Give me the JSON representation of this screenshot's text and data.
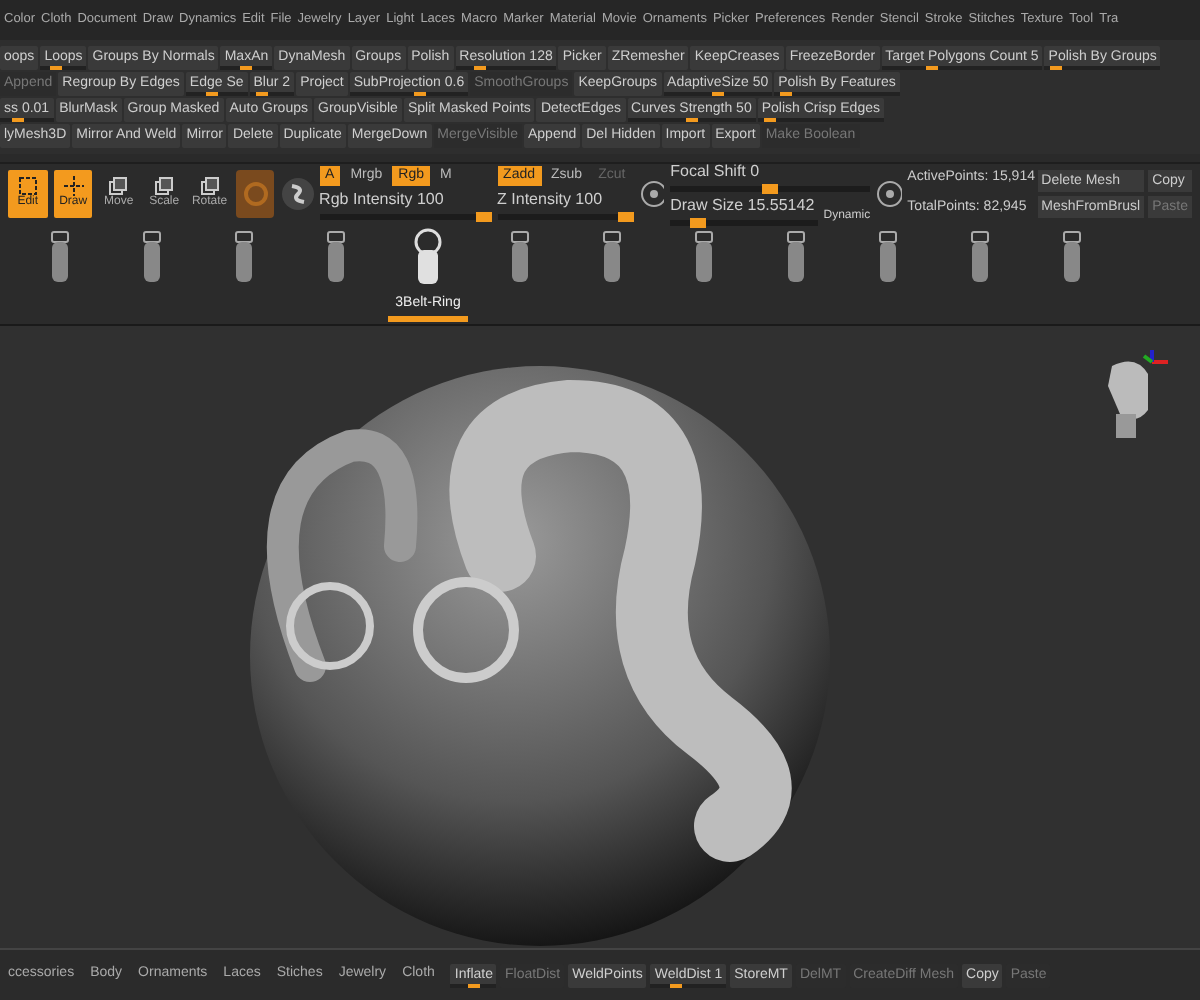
{
  "menu": [
    "Color",
    "Cloth",
    "Document",
    "Draw",
    "Dynamics",
    "Edit",
    "File",
    "Jewelry",
    "Layer",
    "Light",
    "Laces",
    "Macro",
    "Marker",
    "Material",
    "Movie",
    "Ornaments",
    "Picker",
    "Preferences",
    "Render",
    "Stencil",
    "Stroke",
    "Stitches",
    "Texture",
    "Tool",
    "Tra"
  ],
  "palette": [
    [
      {
        "label": "oops",
        "kind": "button"
      },
      {
        "label": "Loops",
        "kind": "slider",
        "level": 0.3
      },
      {
        "label": "Groups By Normals",
        "kind": "button"
      },
      {
        "label": "MaxAn",
        "kind": "slider",
        "level": 0.5
      },
      {
        "label": "DynaMesh",
        "kind": "button"
      },
      {
        "label": "Groups",
        "kind": "button"
      },
      {
        "label": "Polish",
        "kind": "button"
      },
      {
        "label": "Resolution 128",
        "kind": "slider",
        "level": 0.2
      },
      {
        "label": "Picker",
        "kind": "button"
      },
      {
        "label": "ZRemesher",
        "kind": "button"
      },
      {
        "label": "KeepCreases",
        "kind": "button"
      },
      {
        "label": "FreezeBorder",
        "kind": "button"
      },
      {
        "label": "Target Polygons Count 5",
        "kind": "slider",
        "level": 0.3
      },
      {
        "label": "Polish By Groups",
        "kind": "slider",
        "level": 0.05
      }
    ],
    [
      {
        "label": "Append",
        "kind": "button",
        "disabled": true
      },
      {
        "label": "Regroup By Edges",
        "kind": "button"
      },
      {
        "label": "Edge Se",
        "kind": "slider",
        "level": 0.4
      },
      {
        "label": "Blur 2",
        "kind": "slider",
        "level": 0.2
      },
      {
        "label": "Project",
        "kind": "button"
      },
      {
        "label": "SubProjection 0.6",
        "kind": "slider",
        "level": 0.6
      },
      {
        "label": "SmoothGroups",
        "kind": "button",
        "disabled": true
      },
      {
        "label": "KeepGroups",
        "kind": "button"
      },
      {
        "label": "AdaptiveSize 50",
        "kind": "slider",
        "level": 0.5
      },
      {
        "label": "Polish By Features",
        "kind": "slider",
        "level": 0.05
      }
    ],
    [
      {
        "label": "ss 0.01",
        "kind": "slider",
        "level": 0.3
      },
      {
        "label": "BlurMask",
        "kind": "button"
      },
      {
        "label": "Group Masked",
        "kind": "button"
      },
      {
        "label": "Auto Groups",
        "kind": "button"
      },
      {
        "label": "GroupVisible",
        "kind": "button"
      },
      {
        "label": "Split Masked Points",
        "kind": "button"
      },
      {
        "label": "DetectEdges",
        "kind": "button"
      },
      {
        "label": "Curves Strength 50",
        "kind": "slider",
        "level": 0.5
      },
      {
        "label": "Polish Crisp Edges",
        "kind": "slider",
        "level": 0.05
      }
    ],
    [
      {
        "label": "lyMesh3D",
        "kind": "button"
      },
      {
        "label": "Mirror And Weld",
        "kind": "button"
      },
      {
        "label": "Mirror",
        "kind": "button"
      },
      {
        "label": "Delete",
        "kind": "button"
      },
      {
        "label": "Duplicate",
        "kind": "button"
      },
      {
        "label": "MergeDown",
        "kind": "button"
      },
      {
        "label": "MergeVisible",
        "kind": "button",
        "disabled": true
      },
      {
        "label": "Append",
        "kind": "button"
      },
      {
        "label": "Del Hidden",
        "kind": "button"
      },
      {
        "label": "Import",
        "kind": "button"
      },
      {
        "label": "Export",
        "kind": "button"
      },
      {
        "label": "Make Boolean",
        "kind": "button",
        "disabled": true
      }
    ]
  ],
  "tools": [
    {
      "label": "Edit",
      "selected": true
    },
    {
      "label": "Draw",
      "selected": true
    },
    {
      "label": "Move",
      "selected": false
    },
    {
      "label": "Scale",
      "selected": false
    },
    {
      "label": "Rotate",
      "selected": false
    }
  ],
  "color_modes": [
    {
      "label": "A",
      "selected": true
    },
    {
      "label": "Mrgb",
      "selected": false
    },
    {
      "label": "Rgb",
      "selected": true
    },
    {
      "label": "M",
      "selected": false
    }
  ],
  "rgb_intensity": {
    "label": "Rgb Intensity 100",
    "level": 1
  },
  "z_modes": [
    {
      "label": "Zadd",
      "selected": true,
      "disabled": false
    },
    {
      "label": "Zsub",
      "selected": false,
      "disabled": false
    },
    {
      "label": "Zcut",
      "selected": false,
      "disabled": true
    }
  ],
  "z_intensity": {
    "label": "Z Intensity 100",
    "level": 1
  },
  "focal_shift": {
    "label": "Focal Shift 0",
    "level": 0.5
  },
  "draw_size": {
    "label": "Draw Size 15.55142",
    "level": 0.15,
    "dynamic": "Dynamic"
  },
  "stats": [
    "ActivePoints: 15,914",
    "TotalPoints: 82,945"
  ],
  "mesh_buttons": [
    {
      "label": "Delete Mesh",
      "disabled": false
    },
    {
      "label": "Copy",
      "disabled": false
    },
    {
      "label": "MeshFromBrusl",
      "disabled": false
    },
    {
      "label": "Paste",
      "disabled": true
    }
  ],
  "brushes": [
    {
      "selected": false
    },
    {
      "selected": false
    },
    {
      "selected": false
    },
    {
      "selected": false
    },
    {
      "label": "3Belt-Ring",
      "selected": true
    },
    {
      "selected": false
    },
    {
      "selected": false
    },
    {
      "selected": false
    },
    {
      "selected": false
    },
    {
      "selected": false
    },
    {
      "selected": false
    },
    {
      "selected": false
    }
  ],
  "bottom_tabs": [
    "ccessories",
    "Body",
    "Ornaments",
    "Laces",
    "Stiches",
    "Jewelry",
    "Cloth"
  ],
  "bottom_controls": [
    {
      "label": "Inflate",
      "kind": "slider",
      "level": 0.5,
      "disabled": false
    },
    {
      "label": "FloatDist",
      "kind": "button",
      "disabled": true
    },
    {
      "label": "WeldPoints",
      "kind": "button",
      "disabled": false
    },
    {
      "label": "WeldDist 1",
      "kind": "slider",
      "level": 0.3,
      "disabled": false
    },
    {
      "label": "StoreMT",
      "kind": "button",
      "disabled": false
    },
    {
      "label": "DelMT",
      "kind": "button",
      "disabled": true
    },
    {
      "label": "CreateDiff Mesh",
      "kind": "button",
      "disabled": true
    },
    {
      "label": "Copy",
      "kind": "button",
      "disabled": false
    },
    {
      "label": "Paste",
      "kind": "button",
      "disabled": true
    }
  ]
}
